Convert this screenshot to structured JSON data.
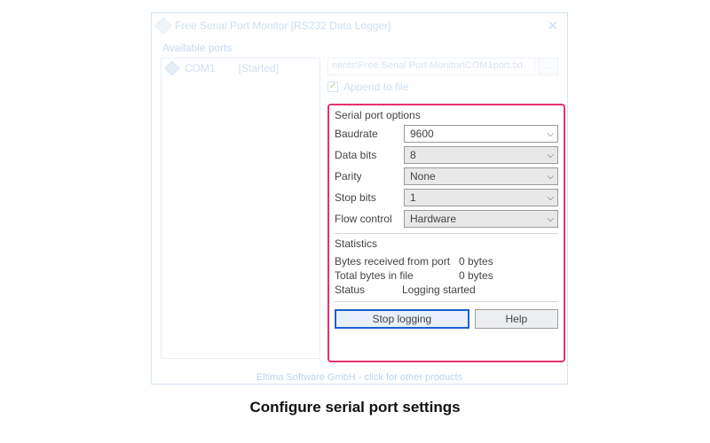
{
  "window": {
    "title": "Free Serial Port Monitor [RS232 Data Logger]"
  },
  "available_ports_label": "Available ports",
  "ports": [
    {
      "name": "COM1",
      "status": "[Started]"
    }
  ],
  "file": {
    "path_fragment": "nents\\Free Serial Port Monitor\\COM1port.txt",
    "browse": "...",
    "append_label": "Append to file"
  },
  "options": {
    "group_label": "Serial port options",
    "baudrate_label": "Baudrate",
    "baudrate_value": "9600",
    "databits_label": "Data bits",
    "databits_value": "8",
    "parity_label": "Parity",
    "parity_value": "None",
    "stopbits_label": "Stop bits",
    "stopbits_value": "1",
    "flow_label": "Flow control",
    "flow_value": "Hardware"
  },
  "stats": {
    "group_label": "Statistics",
    "bytes_received_label": "Bytes received from port",
    "bytes_received_value": "0 bytes",
    "total_bytes_label": "Total bytes in file",
    "total_bytes_value": "0 bytes",
    "status_label": "Status",
    "status_value": "Logging started"
  },
  "buttons": {
    "stop": "Stop logging",
    "help": "Help"
  },
  "footer": "Eltima Software GmbH - click for other products",
  "caption": "Configure serial port settings"
}
